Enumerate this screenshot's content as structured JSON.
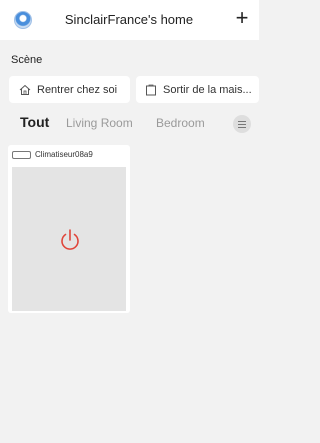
{
  "header": {
    "home_title": "SinclairFrance's home",
    "avatar_icon": "home-avatar-icon",
    "add_icon": "plus-icon",
    "add_label": "+"
  },
  "scenes": {
    "section_label": "Scène",
    "items": [
      {
        "label": "Rentrer chez soi",
        "icon": "house-icon"
      },
      {
        "label": "Sortir de la mais...",
        "icon": "door-exit-icon"
      }
    ]
  },
  "tabs": {
    "items": [
      {
        "label": "Tout",
        "active": true
      },
      {
        "label": "Living Room",
        "active": false
      },
      {
        "label": "Bedroom",
        "active": false
      }
    ],
    "menu_icon": "hamburger-menu-icon"
  },
  "devices": [
    {
      "name": "Climatiseur08a9",
      "icon": "air-conditioner-icon",
      "power_icon": "power-icon",
      "power_color": "#e0453a"
    }
  ],
  "colors": {
    "background": "#f2f2f2",
    "card": "#ffffff",
    "panel": "#e4e4e4",
    "power": "#e0453a",
    "inactive_tab": "#9a9a9a"
  }
}
